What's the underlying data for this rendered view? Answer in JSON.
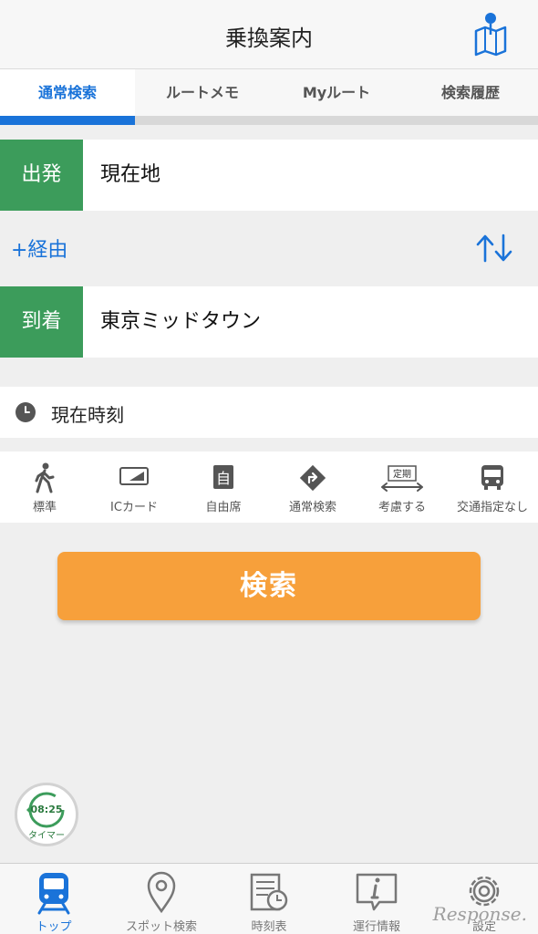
{
  "header": {
    "title": "乗換案内",
    "map_icon": "map-pin-icon"
  },
  "tabs": [
    {
      "label": "通常検索",
      "active": true
    },
    {
      "label": "ルートメモ",
      "active": false
    },
    {
      "label": "Myルート",
      "active": false
    },
    {
      "label": "検索履歴",
      "active": false
    }
  ],
  "departure": {
    "label": "出発",
    "value": "現在地"
  },
  "via": {
    "label": "+経由",
    "swap_icon": "swap-arrows-icon"
  },
  "arrival": {
    "label": "到着",
    "value": "東京ミッドタウン"
  },
  "time": {
    "label": "現在時刻",
    "icon": "clock-icon"
  },
  "options": [
    {
      "label": "標準",
      "icon": "walking-icon"
    },
    {
      "label": "ICカード",
      "icon": "ic-card-icon"
    },
    {
      "label": "自由席",
      "icon": "seat-icon"
    },
    {
      "label": "通常検索",
      "icon": "route-sign-icon"
    },
    {
      "label": "考慮する",
      "icon": "commuter-pass-icon",
      "badge": "定期"
    },
    {
      "label": "交通指定なし",
      "icon": "bus-icon"
    }
  ],
  "search_button": "検索",
  "timer": {
    "time": "08:25",
    "label": "タイマー"
  },
  "bottom_nav": [
    {
      "label": "トップ",
      "icon": "train-icon",
      "active": true
    },
    {
      "label": "スポット検索",
      "icon": "location-pin-icon",
      "active": false
    },
    {
      "label": "時刻表",
      "icon": "timetable-icon",
      "active": false
    },
    {
      "label": "運行情報",
      "icon": "info-icon",
      "active": false
    },
    {
      "label": "設定",
      "icon": "gear-icon",
      "active": false
    }
  ],
  "watermark": "Response.",
  "colors": {
    "accent": "#1a73d9",
    "green": "#3c9c5b",
    "orange": "#f7a03b"
  }
}
